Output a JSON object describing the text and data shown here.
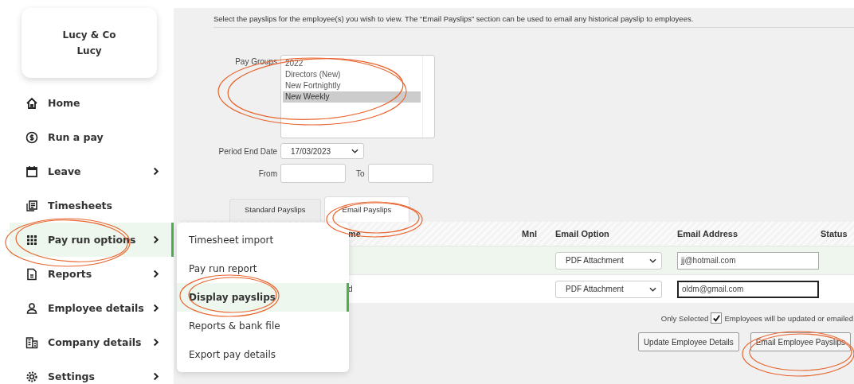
{
  "company": {
    "name": "Lucy & Co",
    "user": "Lucy"
  },
  "nav": [
    {
      "label": "Home",
      "has_submenu": false,
      "selected": false
    },
    {
      "label": "Run a pay",
      "has_submenu": false,
      "selected": false
    },
    {
      "label": "Leave",
      "has_submenu": true,
      "selected": false
    },
    {
      "label": "Timesheets",
      "has_submenu": false,
      "selected": false
    },
    {
      "label": "Pay run options",
      "has_submenu": true,
      "selected": true
    },
    {
      "label": "Reports",
      "has_submenu": true,
      "selected": false
    },
    {
      "label": "Employee details",
      "has_submenu": true,
      "selected": false
    },
    {
      "label": "Company details",
      "has_submenu": true,
      "selected": false
    },
    {
      "label": "Settings",
      "has_submenu": true,
      "selected": false
    }
  ],
  "submenu": [
    {
      "label": "Timesheet import",
      "selected": false
    },
    {
      "label": "Pay run report",
      "selected": false
    },
    {
      "label": "Display payslips",
      "selected": true
    },
    {
      "label": "Reports & bank file",
      "selected": false
    },
    {
      "label": "Export pay details",
      "selected": false
    }
  ],
  "intro": "Select the payslips for the employee(s) you wish to view. The “Email Payslips” section can be used to email any historical payslip to employees.",
  "pay_groups": {
    "label": "Pay Groups",
    "options": [
      {
        "label": "2022",
        "selected": false
      },
      {
        "label": "Directors (New)",
        "selected": false
      },
      {
        "label": "New Fortnightly",
        "selected": false
      },
      {
        "label": "New Weekly",
        "selected": true
      }
    ]
  },
  "period_end": {
    "label": "Period End Date",
    "value": "17/03/2023"
  },
  "from": {
    "label": "From"
  },
  "to": {
    "label": "To"
  },
  "tabs": [
    {
      "label": "Standard Payslips",
      "selected": false
    },
    {
      "label": "Email Payslips",
      "selected": true
    }
  ],
  "table": {
    "columns": [
      "me",
      "Mnl",
      "Email Option",
      "Email Address",
      "Status"
    ],
    "rows": [
      {
        "name": "",
        "email_option": "PDF Attachment",
        "email": "jj@hotmail.com",
        "highlighted": true,
        "focused": false
      },
      {
        "name": "d",
        "email_option": "PDF Attachment",
        "email": "oldm@gmail.com",
        "highlighted": false,
        "focused": true
      }
    ]
  },
  "only_selected": {
    "label_before": "Only Selected",
    "checked": true,
    "label_after": "Employees will be updated or emailed"
  },
  "buttons": [
    "Update Employee Details",
    "Email Employee Payslips"
  ]
}
